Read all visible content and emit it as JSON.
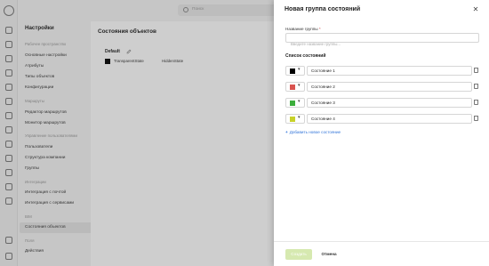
{
  "search": {
    "placeholder": "Поиск"
  },
  "sidebar": {
    "title": "Настройки",
    "sections": [
      {
        "label": "Рабочее пространство"
      },
      {
        "label": "Маршруты"
      },
      {
        "label": "Управление пользователями"
      },
      {
        "label": "Интеграции"
      },
      {
        "label": "BIM"
      },
      {
        "label": "Поля"
      }
    ],
    "items": [
      {
        "label": "Основные настройки"
      },
      {
        "label": "Атрибуты"
      },
      {
        "label": "Типы объектов"
      },
      {
        "label": "Конфигурации"
      },
      {
        "label": "Редактор маршрутов"
      },
      {
        "label": "Монитор маршрутов"
      },
      {
        "label": "Пользователи"
      },
      {
        "label": "Структура компании"
      },
      {
        "label": "Группы"
      },
      {
        "label": "Интеграция с почтой"
      },
      {
        "label": "Интеграция с сервисами"
      },
      {
        "label": "Состояния объектов"
      },
      {
        "label": "Действия"
      }
    ]
  },
  "main": {
    "title": "Состояния объектов",
    "group_name": "Default",
    "states": [
      "TransparentState",
      "HiddenState"
    ]
  },
  "modal": {
    "title": "Новая группа состояний",
    "group_label": "Название группы",
    "group_required_mark": "*",
    "group_placeholder": "Введите название группы...",
    "group_value": "",
    "list_title": "Список состояний",
    "states": [
      {
        "name": "Состояние 1",
        "color": "#000000"
      },
      {
        "name": "Состояние 2",
        "color": "#d9534f"
      },
      {
        "name": "Состояние 3",
        "color": "#3cae3c"
      },
      {
        "name": "Состояние 4",
        "color": "#c8d22a"
      }
    ],
    "add_state_label": "Добавить новое состояние",
    "save_label": "Создать",
    "cancel_label": "Отмена"
  }
}
